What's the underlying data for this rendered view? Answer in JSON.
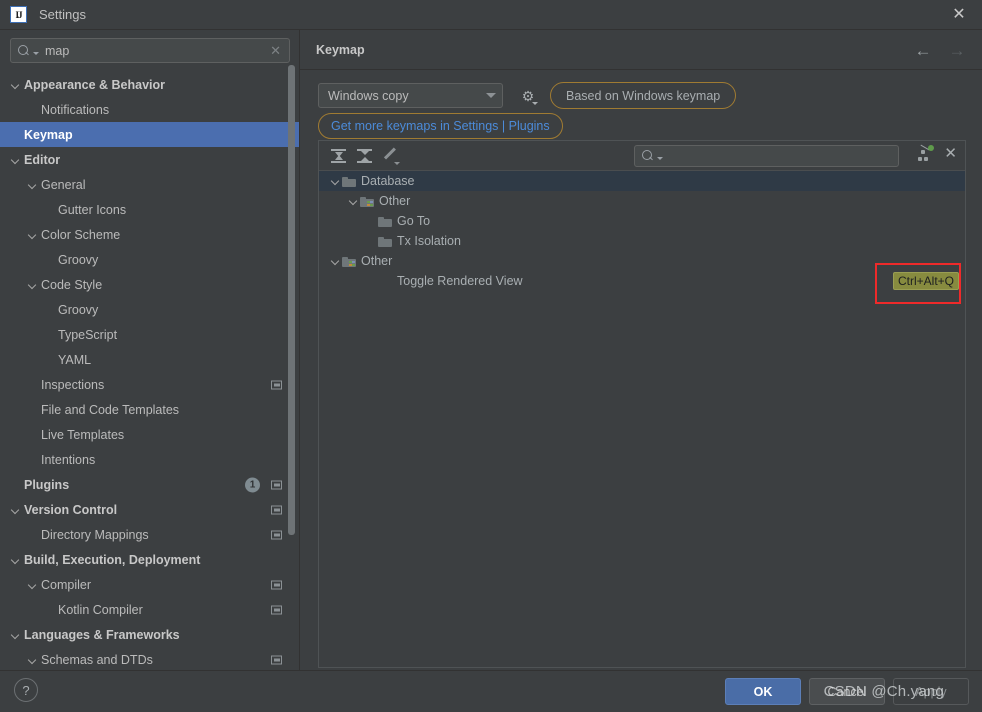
{
  "window": {
    "title": "Settings",
    "logo_text": "IJ",
    "close_label": "✕"
  },
  "sidebar": {
    "search": {
      "value": "map",
      "clear_label": "✕"
    },
    "items": [
      {
        "label": "Appearance & Behavior",
        "indent": 0,
        "chevron": true,
        "bold": true,
        "selected": false
      },
      {
        "label": "Notifications",
        "indent": 1,
        "chevron": false,
        "bold": false,
        "selected": false
      },
      {
        "label": "Keymap",
        "indent": 0,
        "chevron": false,
        "bold": true,
        "selected": true
      },
      {
        "label": "Editor",
        "indent": 0,
        "chevron": true,
        "bold": true,
        "selected": false
      },
      {
        "label": "General",
        "indent": 1,
        "chevron": true,
        "bold": false,
        "selected": false
      },
      {
        "label": "Gutter Icons",
        "indent": 2,
        "chevron": false,
        "bold": false,
        "selected": false
      },
      {
        "label": "Color Scheme",
        "indent": 1,
        "chevron": true,
        "bold": false,
        "selected": false
      },
      {
        "label": "Groovy",
        "indent": 2,
        "chevron": false,
        "bold": false,
        "selected": false
      },
      {
        "label": "Code Style",
        "indent": 1,
        "chevron": true,
        "bold": false,
        "selected": false
      },
      {
        "label": "Groovy",
        "indent": 2,
        "chevron": false,
        "bold": false,
        "selected": false
      },
      {
        "label": "TypeScript",
        "indent": 2,
        "chevron": false,
        "bold": false,
        "selected": false
      },
      {
        "label": "YAML",
        "indent": 2,
        "chevron": false,
        "bold": false,
        "selected": false
      },
      {
        "label": "Inspections",
        "indent": 1,
        "chevron": false,
        "bold": false,
        "selected": false,
        "window_icon": true
      },
      {
        "label": "File and Code Templates",
        "indent": 1,
        "chevron": false,
        "bold": false,
        "selected": false
      },
      {
        "label": "Live Templates",
        "indent": 1,
        "chevron": false,
        "bold": false,
        "selected": false
      },
      {
        "label": "Intentions",
        "indent": 1,
        "chevron": false,
        "bold": false,
        "selected": false
      },
      {
        "label": "Plugins",
        "indent": 0,
        "chevron": false,
        "bold": true,
        "selected": false,
        "badge": "1",
        "window_icon": true
      },
      {
        "label": "Version Control",
        "indent": 0,
        "chevron": true,
        "bold": true,
        "selected": false,
        "window_icon": true
      },
      {
        "label": "Directory Mappings",
        "indent": 1,
        "chevron": false,
        "bold": false,
        "selected": false,
        "window_icon": true
      },
      {
        "label": "Build, Execution, Deployment",
        "indent": 0,
        "chevron": true,
        "bold": true,
        "selected": false
      },
      {
        "label": "Compiler",
        "indent": 1,
        "chevron": true,
        "bold": false,
        "selected": false,
        "window_icon": true
      },
      {
        "label": "Kotlin Compiler",
        "indent": 2,
        "chevron": false,
        "bold": false,
        "selected": false,
        "window_icon": true
      },
      {
        "label": "Languages & Frameworks",
        "indent": 0,
        "chevron": true,
        "bold": true,
        "selected": false
      },
      {
        "label": "Schemas and DTDs",
        "indent": 1,
        "chevron": true,
        "bold": false,
        "selected": false,
        "window_icon": true
      }
    ]
  },
  "main": {
    "title": "Keymap",
    "nav_back": "←",
    "nav_forward": "→",
    "keymap_select": {
      "value": "Windows copy"
    },
    "gear_icon_label": "⚙",
    "based_on_pill": "Based on Windows keymap",
    "get_more_link": "Get more keymaps in Settings | Plugins",
    "toolbar": {
      "expand_all_title": "Expand All",
      "collapse_all_title": "Collapse All",
      "edit_title": "Edit Shortcut",
      "search_placeholder": "",
      "search_value": "",
      "filter_title": "Filter",
      "clear_label": "✕"
    },
    "tree": [
      {
        "label": "Database",
        "indent": 0,
        "chevron": true,
        "folder": "plain",
        "selected": true,
        "shortcut": ""
      },
      {
        "label": "Other",
        "indent": 1,
        "chevron": true,
        "folder": "colored",
        "selected": false,
        "shortcut": ""
      },
      {
        "label": "Go To",
        "indent": 2,
        "chevron": false,
        "folder": "plain",
        "selected": false,
        "shortcut": ""
      },
      {
        "label": "Tx Isolation",
        "indent": 2,
        "chevron": false,
        "folder": "plain",
        "selected": false,
        "shortcut": ""
      },
      {
        "label": "Other",
        "indent": 0,
        "chevron": true,
        "folder": "colored",
        "selected": false,
        "shortcut": ""
      },
      {
        "label": "Toggle Rendered View",
        "indent": 2,
        "chevron": false,
        "folder": "none",
        "selected": false,
        "shortcut": "Ctrl+Alt+Q"
      }
    ]
  },
  "footer": {
    "help_label": "?",
    "ok_label": "OK",
    "cancel_label": "Cancel",
    "apply_label": "Apply"
  },
  "watermark": {
    "text": "CSDN @Ch.yang"
  },
  "colors": {
    "background": "#3c3f41",
    "selection_blue": "#4b6eaf",
    "tree_selection": "#2f3a46",
    "accent_orange": "#a07b32",
    "link_blue": "#4c8bd9",
    "shortcut_highlight": "#878b3f",
    "annotation_red": "#ef2a2a",
    "ok_button": "#4a6da7"
  }
}
